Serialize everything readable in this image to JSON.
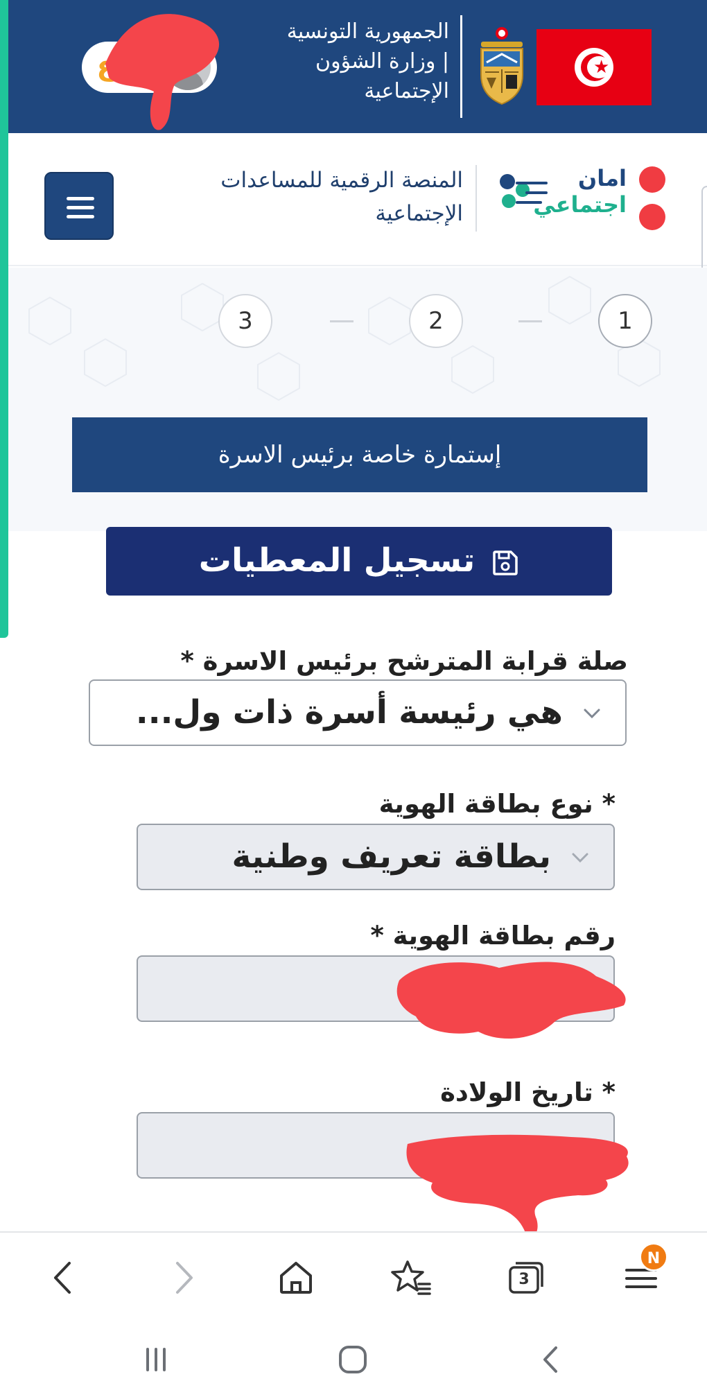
{
  "gov_header": {
    "line1": "الجمهورية التونسية",
    "line2": "| وزارة الشؤون",
    "line3": "الإجتماعية",
    "user_badge": "ع"
  },
  "site_header": {
    "title_line1": "المنصة الرقمية للمساعدات",
    "title_line2": "الإجتماعية",
    "logo_line1": "امان",
    "logo_line2": "اجتماعي"
  },
  "steps": [
    "1",
    "2",
    "3"
  ],
  "form": {
    "banner": "إستمارة خاصة برئيس الاسرة",
    "save_label": "تسجيل المعطيات",
    "relation_label": "صلة قرابة المترشح برئيس الاسرة *",
    "relation_value": "هي رئيسة أسرة ذات ول...",
    "id_type_label": "* نوع بطاقة الهوية",
    "id_type_value": "بطاقة تعريف وطنية",
    "id_number_label": "رقم بطاقة الهوية *",
    "birth_date_label": "* تاريخ الولادة"
  },
  "browser": {
    "tabs_count": "3",
    "notification_badge": "N"
  },
  "colors": {
    "primary_blue": "#1f477e",
    "save_button": "#1b2f73",
    "flag_red": "#e70013",
    "accent_green": "#1fc59a",
    "logo_red": "#f03c42",
    "notification_orange": "#f07b12"
  },
  "icons": [
    "back-icon",
    "forward-icon",
    "home-icon",
    "bookmarks-icon",
    "tabs-icon",
    "menu-icon",
    "save-icon",
    "chevron-down-icon",
    "recents-icon",
    "android-home-icon",
    "android-back-icon"
  ]
}
